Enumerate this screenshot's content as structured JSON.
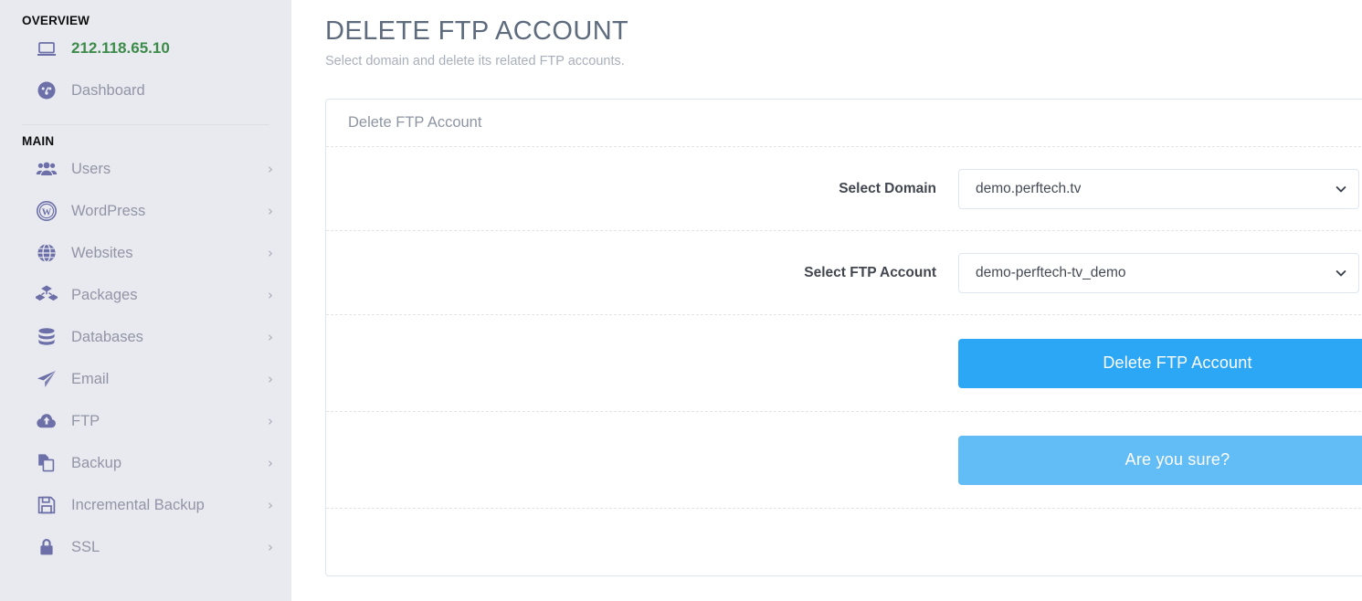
{
  "sidebar": {
    "sections": [
      {
        "title": "OVERVIEW",
        "items": [
          {
            "label": "212.118.65.10",
            "icon": "laptop-icon",
            "kind": "ip",
            "chevron": false
          },
          {
            "label": "Dashboard",
            "icon": "speedometer-icon",
            "kind": "normal",
            "chevron": false
          }
        ]
      },
      {
        "title": "MAIN",
        "items": [
          {
            "label": "Users",
            "icon": "users-icon",
            "kind": "normal",
            "chevron": true
          },
          {
            "label": "WordPress",
            "icon": "wordpress-icon",
            "kind": "normal",
            "chevron": true
          },
          {
            "label": "Websites",
            "icon": "globe-icon",
            "kind": "normal",
            "chevron": true
          },
          {
            "label": "Packages",
            "icon": "packages-icon",
            "kind": "normal",
            "chevron": true
          },
          {
            "label": "Databases",
            "icon": "database-icon",
            "kind": "normal",
            "chevron": true
          },
          {
            "label": "Email",
            "icon": "paper-plane-icon",
            "kind": "normal",
            "chevron": true
          },
          {
            "label": "FTP",
            "icon": "cloud-upload-icon",
            "kind": "normal",
            "chevron": true
          },
          {
            "label": "Backup",
            "icon": "copy-icon",
            "kind": "normal",
            "chevron": true
          },
          {
            "label": "Incremental Backup",
            "icon": "floppy-disk-icon",
            "kind": "normal",
            "chevron": true
          },
          {
            "label": "SSL",
            "icon": "lock-icon",
            "kind": "normal",
            "chevron": true
          }
        ]
      }
    ]
  },
  "page": {
    "title": "DELETE FTP ACCOUNT",
    "subtitle": "Select domain and delete its related FTP accounts."
  },
  "panel": {
    "heading": "Delete FTP Account",
    "domain_row": {
      "label": "Select Domain",
      "value": "demo.perftech.tv",
      "caret": "chevron-down-icon"
    },
    "ftp_row": {
      "label": "Select FTP Account",
      "value": "demo-perftech-tv_demo",
      "caret": "chevron-down-icon"
    },
    "delete_button": "Delete FTP Account",
    "confirm_button": "Are you sure?"
  },
  "colors": {
    "sidebar_bg": "#e9eaef",
    "ip_green": "#3d8b4a",
    "icon_purple": "#6c6fa8",
    "primary_blue": "#2ba7f6",
    "confirm_blue": "#62bdf7",
    "panel_border": "#dfe6ef"
  }
}
